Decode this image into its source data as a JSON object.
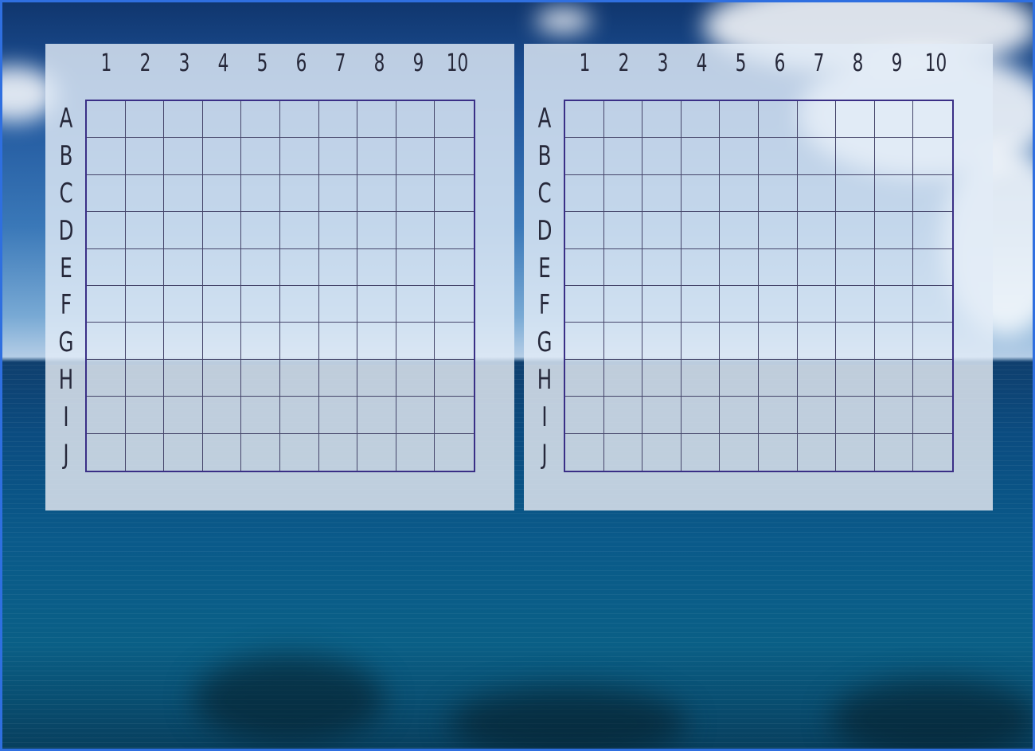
{
  "boards": [
    {
      "columns": [
        "1",
        "2",
        "3",
        "4",
        "5",
        "6",
        "7",
        "8",
        "9",
        "10"
      ],
      "rows": [
        "A",
        "B",
        "C",
        "D",
        "E",
        "F",
        "G",
        "H",
        "I",
        "J"
      ]
    },
    {
      "columns": [
        "1",
        "2",
        "3",
        "4",
        "5",
        "6",
        "7",
        "8",
        "9",
        "10"
      ],
      "rows": [
        "A",
        "B",
        "C",
        "D",
        "E",
        "F",
        "G",
        "H",
        "I",
        "J"
      ]
    }
  ],
  "colors": {
    "frame_border": "#2f6fe0",
    "grid_border": "#3a2f86",
    "grid_line": "#45456a",
    "label_ink": "#26283a"
  },
  "background": {
    "scene": "sky-with-clouds-over-open-sea"
  }
}
